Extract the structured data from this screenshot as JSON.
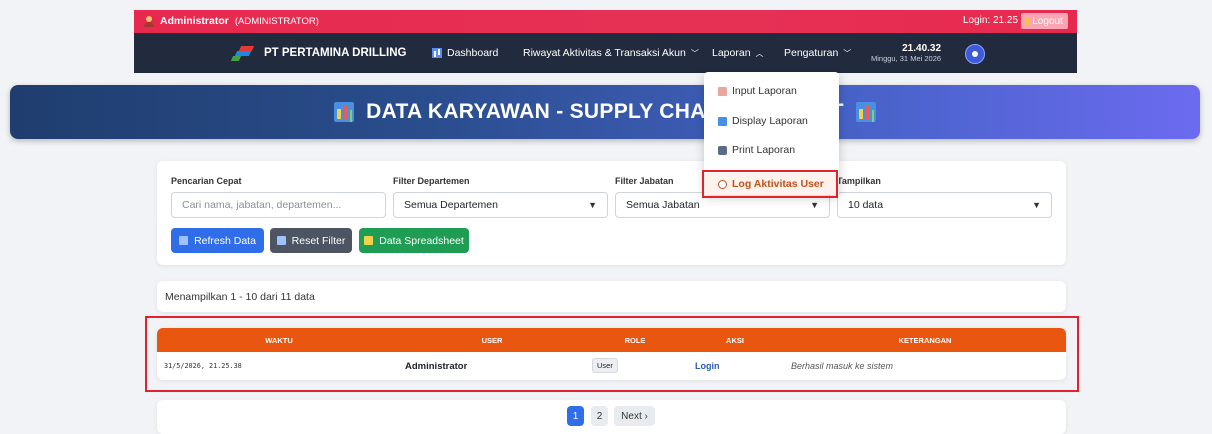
{
  "topbar": {
    "user_name": "Administrator",
    "user_role": "(ADMINISTRATOR)",
    "login_time": "Login: 21.25",
    "logout_label": "Logout"
  },
  "navbar": {
    "brand": "PT PERTAMINA DRILLING",
    "items": [
      {
        "label": "Dashboard"
      },
      {
        "label": "Riwayat Aktivitas & Transaksi Akun"
      },
      {
        "label": "Laporan"
      },
      {
        "label": "Pengaturan"
      }
    ],
    "clock_time": "21.40.32",
    "clock_date": "Minggu, 31 Mei 2026"
  },
  "dropdown": {
    "items": [
      {
        "label": "Input Laporan",
        "icon": "memo-icon"
      },
      {
        "label": "Display Laporan",
        "icon": "chart-icon"
      },
      {
        "label": "Print Laporan",
        "icon": "printer-icon"
      },
      {
        "label": "Log Aktivitas User",
        "icon": "clock-icon",
        "active": true
      }
    ]
  },
  "hero": {
    "title_left": "DATA KARYAWAN - SUPPLY CHAIN",
    "title_right": "NT"
  },
  "filters": {
    "search_label": "Pencarian Cepat",
    "search_placeholder": "Cari nama, jabatan, departemen...",
    "dept_label": "Filter Departemen",
    "dept_value": "Semua Departemen",
    "jabatan_label": "Filter Jabatan",
    "jabatan_value": "Semua Jabatan",
    "tampilkan_label": "Tampilkan",
    "tampilkan_value": "10 data",
    "refresh_label": "Refresh Data",
    "reset_label": "Reset Filter",
    "sheet_label": "Data Spreadsheet"
  },
  "info": {
    "text": "Menampilkan 1 - 10 dari 11 data"
  },
  "table": {
    "headers": [
      "WAKTU",
      "USER",
      "ROLE",
      "AKSI",
      "KETERANGAN"
    ],
    "rows": [
      {
        "waktu": "31/5/2026, 21.25.38",
        "user": "Administrator",
        "role": "User",
        "aksi": "Login",
        "keterangan": "Berhasil masuk ke sistem"
      }
    ]
  },
  "pagination": {
    "pages": [
      "1",
      "2"
    ],
    "current": "1",
    "next_label": "Next ›"
  },
  "colors": {
    "topbar": "#e8294f",
    "navbar": "#222b3d",
    "table_header": "#e8560f",
    "primary": "#2f6ee8",
    "success": "#1f9d55",
    "highlight": "#e1232e"
  }
}
